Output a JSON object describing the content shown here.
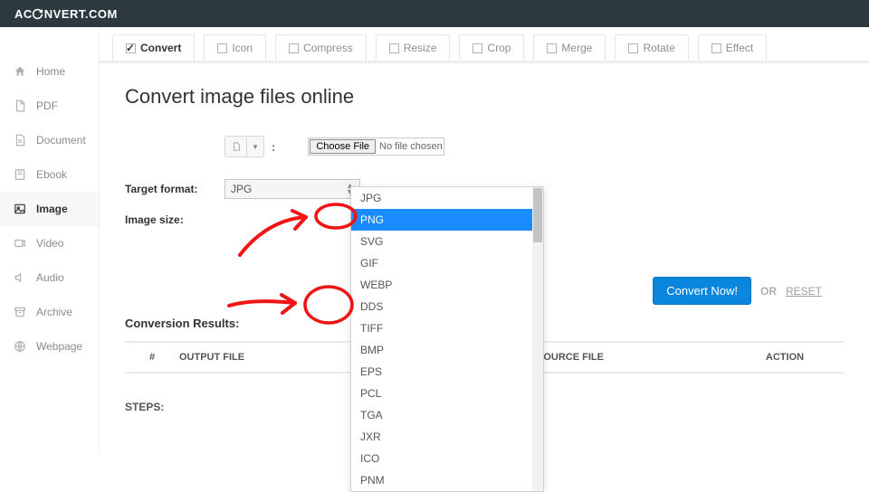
{
  "brand_part1": "AC",
  "brand_part2": "NVERT.COM",
  "sidebar": {
    "items": [
      {
        "label": "Home"
      },
      {
        "label": "PDF"
      },
      {
        "label": "Document"
      },
      {
        "label": "Ebook"
      },
      {
        "label": "Image"
      },
      {
        "label": "Video"
      },
      {
        "label": "Audio"
      },
      {
        "label": "Archive"
      },
      {
        "label": "Webpage"
      }
    ],
    "active_index": 4
  },
  "tabs": {
    "items": [
      {
        "label": "Convert"
      },
      {
        "label": "Icon"
      },
      {
        "label": "Compress"
      },
      {
        "label": "Resize"
      },
      {
        "label": "Crop"
      },
      {
        "label": "Merge"
      },
      {
        "label": "Rotate"
      },
      {
        "label": "Effect"
      }
    ],
    "active_index": 0
  },
  "page_title": "Convert image files online",
  "labels": {
    "target_format": "Target format:",
    "image_size": "Image size:",
    "choose_file": "Choose File",
    "no_file": "No file chosen"
  },
  "target_format_selected": "JPG",
  "dropdown_options": [
    "JPG",
    "PNG",
    "SVG",
    "GIF",
    "WEBP",
    "DDS",
    "TIFF",
    "BMP",
    "EPS",
    "PCL",
    "TGA",
    "JXR",
    "ICO",
    "PNM"
  ],
  "dropdown_highlight_index": 1,
  "actions": {
    "convert": "Convert Now!",
    "or": "OR",
    "reset": "RESET"
  },
  "results": {
    "title": "Conversion Results:",
    "col_index": "#",
    "col_output": "OUTPUT FILE",
    "col_source": "SOURCE FILE",
    "col_action": "ACTION"
  },
  "steps_label": "STEPS:",
  "colors": {
    "accent": "#1a8cff",
    "primary_btn": "#0b86df",
    "annotation": "#ef1515"
  }
}
